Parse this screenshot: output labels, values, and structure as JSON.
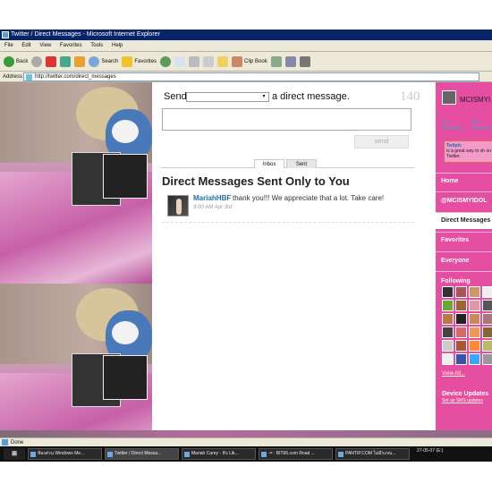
{
  "window": {
    "title": "Twitter / Direct Messages - Microsoft Internet Explorer"
  },
  "menu": [
    "File",
    "Edit",
    "View",
    "Favorites",
    "Tools",
    "Help"
  ],
  "toolbar": {
    "back": "Back",
    "search": "Search",
    "favorites": "Favorites",
    "clipbook": "Clip Book"
  },
  "address": {
    "label": "Address",
    "url": "http://twitter.com/direct_messages"
  },
  "compose": {
    "send_label": "Send",
    "select_value": "",
    "suffix": "a direct message.",
    "char_count": "140",
    "send_button": "send"
  },
  "tabs": {
    "inbox": "Inbox",
    "sent": "Sent"
  },
  "heading": "Direct Messages Sent Only to You",
  "messages": [
    {
      "user": "MariahHBF",
      "text": "thank you!!! We appreciate that a lot. Take care!",
      "meta": "9:00 AM Apr 3rd"
    }
  ],
  "sidebar": {
    "name": "MCISMYI",
    "following_count": "92",
    "following_label": "following",
    "followers_count": "55",
    "followers_label": "followers",
    "bio_user": "Twitpic",
    "bio_text": "is a great way to sh on Twitter.",
    "nav": [
      "Home",
      "@MCISMYIDOL",
      "Direct Messages",
      "Favorites",
      "Everyone"
    ],
    "following_title": "Following",
    "view_all": "View All...",
    "device_title": "Device Updates",
    "device_sub": "Set up SMS updates"
  },
  "status": {
    "text": "Done"
  },
  "taskbar": {
    "items": [
      "ห้องส่วน Windows Me...",
      "Twitter / Direct Messa...",
      "Mariah Carey - It's Lik...",
      "-= : BIT66.com Road ...",
      "PANTIP.COM ไม่มีระบบ..."
    ],
    "clock": "27-05-07 (E:)"
  },
  "colors": {
    "accent": "#e64ea1",
    "titlebar": "#0a246a",
    "link": "#2470a8"
  }
}
